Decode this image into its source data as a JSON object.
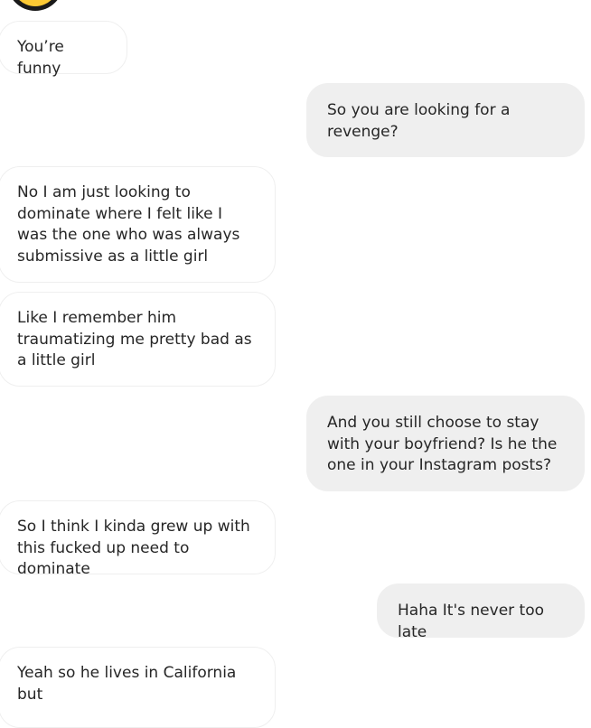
{
  "conversation": {
    "messages": [
      {
        "sender": "other",
        "text": "You’re funny"
      },
      {
        "sender": "me",
        "text": "So you are looking for a revenge?"
      },
      {
        "sender": "other",
        "text": "No I am just looking to dominate where I felt like I was the one who was always submissive as a little girl"
      },
      {
        "sender": "other",
        "text": "Like I remember him traumatizing me pretty bad as a little girl"
      },
      {
        "sender": "me",
        "text": "And you still choose to stay with your boyfriend? Is he the one in your Instagram posts?"
      },
      {
        "sender": "other",
        "text": "So I think I kinda grew up with this fucked up need to dominate"
      },
      {
        "sender": "me",
        "text": "Haha It's never too late"
      },
      {
        "sender": "other",
        "text": "Yeah so he lives in California but"
      }
    ]
  },
  "colors": {
    "incoming_bubble": "#ffffff",
    "incoming_border": "#efefef",
    "outgoing_bubble": "#efefef",
    "text": "#262626",
    "emoji_face": "#fcc934"
  },
  "icons": {
    "emoji": "emoji-face-icon"
  }
}
